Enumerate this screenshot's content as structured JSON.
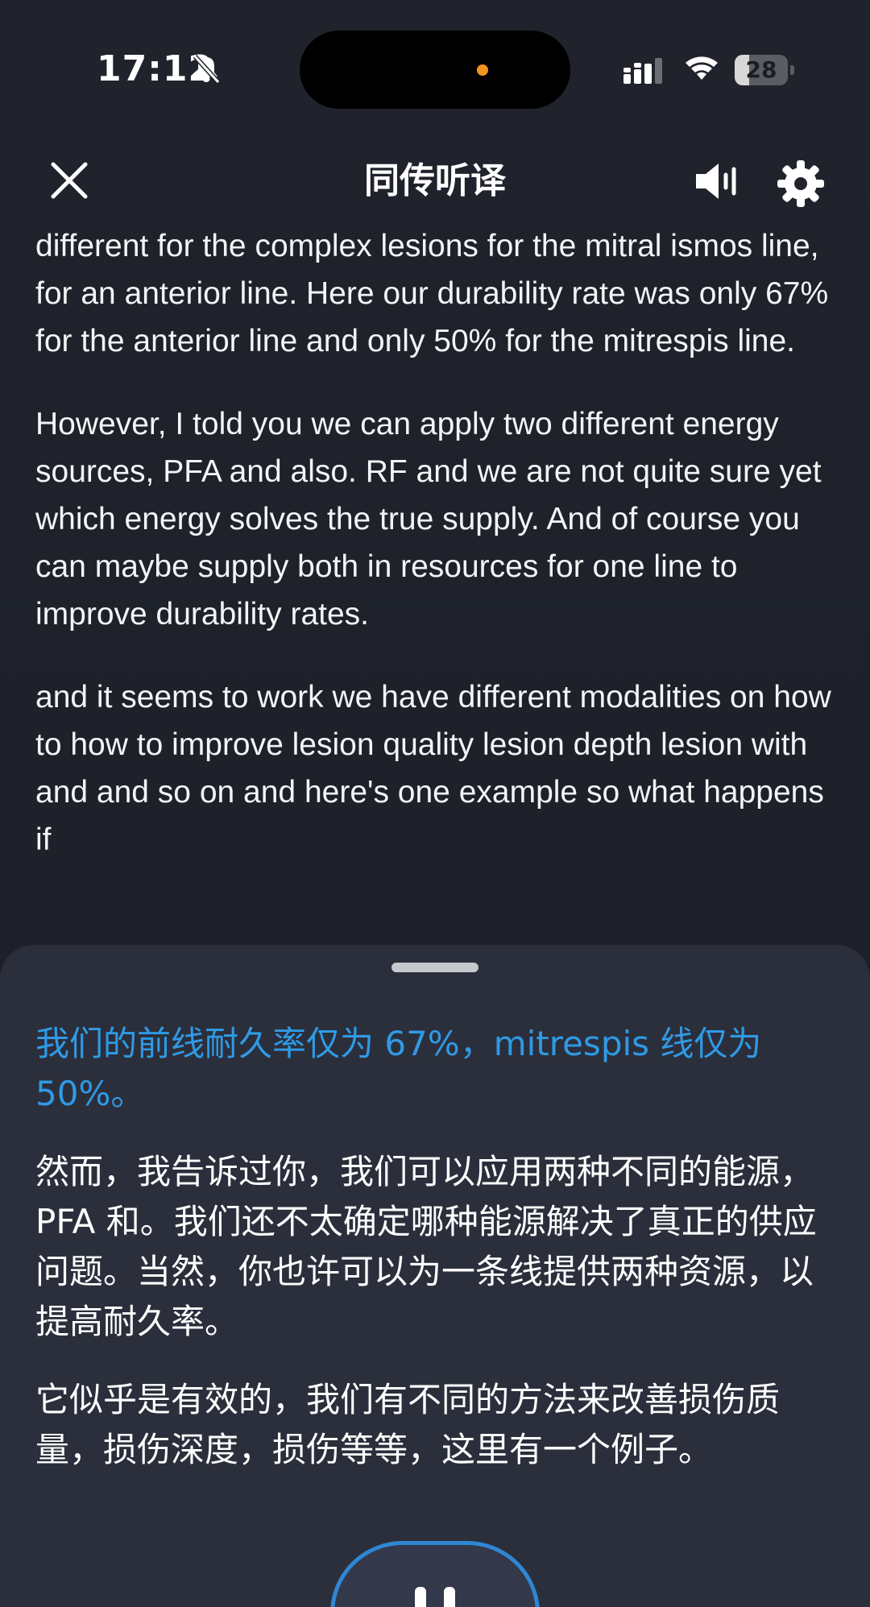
{
  "status_bar": {
    "time": "17:12",
    "battery_level": "28",
    "battery_fraction": 0.28,
    "icons": [
      "bell-off-icon",
      "cellular-signal-icon",
      "wifi-icon",
      "battery-icon"
    ],
    "island_dot_color": "#f29420"
  },
  "header": {
    "title": "同传听译",
    "icons": [
      "close-icon",
      "speaker-icon",
      "gear-icon"
    ]
  },
  "transcript": {
    "paragraphs": [
      "different for the complex lesions for the mitral ismos line, for an anterior line. Here our durability rate was only 67% for the anterior line and only 50% for the mitrespis line.",
      "However, I told you we can apply two different energy sources, PFA and also. RF and we are not quite sure yet which energy solves the true supply. And of course you can maybe supply both in resources for one line to improve durability rates.",
      "and it seems to work we have different modalities on how to how to improve lesion quality lesion depth lesion with and and so on and here's one example so what happens if"
    ]
  },
  "translation": {
    "paragraphs": [
      "我们的前线耐久率仅为 67%，mitrespis 线仅为 50%。",
      "然而，我告诉过你，我们可以应用两种不同的能源，PFA 和。我们还不太确定哪种能源解决了真正的供应问题。当然，你也许可以为一条线提供两种资源，以提高耐久率。",
      "它似乎是有效的，我们有不同的方法来改善损伤质量，损伤深度，损伤等等，这里有一个例子。"
    ],
    "highlight_color": "#2f9ae6"
  },
  "controls": {
    "pause_icon": "pause-icon",
    "accent_color": "#2f86d3"
  }
}
